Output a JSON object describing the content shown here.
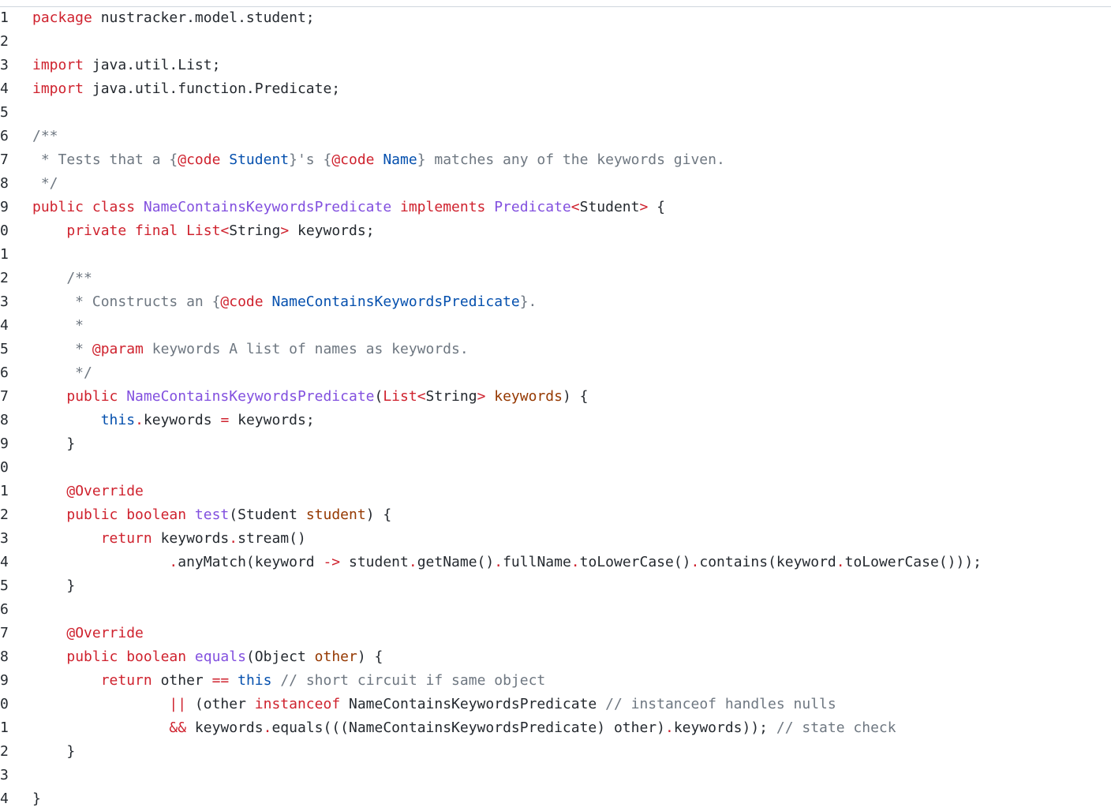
{
  "editor": {
    "line_numbers": [
      "1",
      "2",
      "3",
      "4",
      "5",
      "6",
      "7",
      "8",
      "9",
      "0",
      "1",
      "2",
      "3",
      "4",
      "5",
      "6",
      "7",
      "8",
      "9",
      "0",
      "1",
      "2",
      "3",
      "4",
      "5",
      "6",
      "7",
      "8",
      "9",
      "0",
      "1",
      "2",
      "3",
      "4"
    ],
    "lines": [
      [
        {
          "t": "package",
          "c": "kw"
        },
        {
          "t": " nustracker.model.student;",
          "c": ""
        }
      ],
      [],
      [
        {
          "t": "import",
          "c": "kw"
        },
        {
          "t": " java.util.List;",
          "c": ""
        }
      ],
      [
        {
          "t": "import",
          "c": "kw"
        },
        {
          "t": " java.util.function.Predicate;",
          "c": ""
        }
      ],
      [],
      [
        {
          "t": "/**",
          "c": "cm"
        }
      ],
      [
        {
          "t": " * Tests that a {",
          "c": "cm"
        },
        {
          "t": "@code",
          "c": "kw"
        },
        {
          "t": " Student",
          "c": "cst"
        },
        {
          "t": "}'s {",
          "c": "cm"
        },
        {
          "t": "@code",
          "c": "kw"
        },
        {
          "t": " Name",
          "c": "cst"
        },
        {
          "t": "} matches any of the keywords given.",
          "c": "cm"
        }
      ],
      [
        {
          "t": " */",
          "c": "cm"
        }
      ],
      [
        {
          "t": "public class ",
          "c": "kw"
        },
        {
          "t": "NameContainsKeywordsPredicate",
          "c": "ent"
        },
        {
          "t": " implements ",
          "c": "kw"
        },
        {
          "t": "Predicate",
          "c": "ent"
        },
        {
          "t": "<",
          "c": "op"
        },
        {
          "t": "Student",
          "c": ""
        },
        {
          "t": ">",
          "c": "op"
        },
        {
          "t": " {",
          "c": ""
        }
      ],
      [
        {
          "t": "    ",
          "c": ""
        },
        {
          "t": "private final List",
          "c": "kw"
        },
        {
          "t": "<",
          "c": "op"
        },
        {
          "t": "String",
          "c": ""
        },
        {
          "t": ">",
          "c": "op"
        },
        {
          "t": " keywords;",
          "c": ""
        }
      ],
      [],
      [
        {
          "t": "    /**",
          "c": "cm"
        }
      ],
      [
        {
          "t": "     * Constructs an {",
          "c": "cm"
        },
        {
          "t": "@code",
          "c": "kw"
        },
        {
          "t": " NameContainsKeywordsPredicate",
          "c": "cst"
        },
        {
          "t": "}.",
          "c": "cm"
        }
      ],
      [
        {
          "t": "     *",
          "c": "cm"
        }
      ],
      [
        {
          "t": "     * ",
          "c": "cm"
        },
        {
          "t": "@param",
          "c": "kw"
        },
        {
          "t": " keywords A list of names as keywords.",
          "c": "cm"
        }
      ],
      [
        {
          "t": "     */",
          "c": "cm"
        }
      ],
      [
        {
          "t": "    ",
          "c": ""
        },
        {
          "t": "public ",
          "c": "kw"
        },
        {
          "t": "NameContainsKeywordsPredicate",
          "c": "ent"
        },
        {
          "t": "(",
          "c": ""
        },
        {
          "t": "List",
          "c": "kw"
        },
        {
          "t": "<",
          "c": "op"
        },
        {
          "t": "String",
          "c": ""
        },
        {
          "t": ">",
          "c": "op"
        },
        {
          "t": " keywords",
          "c": "par"
        },
        {
          "t": ") {",
          "c": ""
        }
      ],
      [
        {
          "t": "        ",
          "c": ""
        },
        {
          "t": "this",
          "c": "cst"
        },
        {
          "t": ".",
          "c": "op"
        },
        {
          "t": "keywords ",
          "c": ""
        },
        {
          "t": "=",
          "c": "op"
        },
        {
          "t": " keywords;",
          "c": ""
        }
      ],
      [
        {
          "t": "    }",
          "c": ""
        }
      ],
      [],
      [
        {
          "t": "    ",
          "c": ""
        },
        {
          "t": "@Override",
          "c": "kw"
        }
      ],
      [
        {
          "t": "    ",
          "c": ""
        },
        {
          "t": "public boolean ",
          "c": "kw"
        },
        {
          "t": "test",
          "c": "ent"
        },
        {
          "t": "(Student ",
          "c": ""
        },
        {
          "t": "student",
          "c": "par"
        },
        {
          "t": ") {",
          "c": ""
        }
      ],
      [
        {
          "t": "        ",
          "c": ""
        },
        {
          "t": "return",
          "c": "kw"
        },
        {
          "t": " keywords",
          "c": ""
        },
        {
          "t": ".",
          "c": "op"
        },
        {
          "t": "stream()",
          "c": ""
        }
      ],
      [
        {
          "t": "                ",
          "c": ""
        },
        {
          "t": ".",
          "c": "op"
        },
        {
          "t": "anyMatch(keyword ",
          "c": ""
        },
        {
          "t": "->",
          "c": "op"
        },
        {
          "t": " student",
          "c": ""
        },
        {
          "t": ".",
          "c": "op"
        },
        {
          "t": "getName()",
          "c": ""
        },
        {
          "t": ".",
          "c": "op"
        },
        {
          "t": "fullName",
          "c": ""
        },
        {
          "t": ".",
          "c": "op"
        },
        {
          "t": "toLowerCase()",
          "c": ""
        },
        {
          "t": ".",
          "c": "op"
        },
        {
          "t": "contains(keyword",
          "c": ""
        },
        {
          "t": ".",
          "c": "op"
        },
        {
          "t": "toLowerCase()));",
          "c": ""
        }
      ],
      [
        {
          "t": "    }",
          "c": ""
        }
      ],
      [],
      [
        {
          "t": "    ",
          "c": ""
        },
        {
          "t": "@Override",
          "c": "kw"
        }
      ],
      [
        {
          "t": "    ",
          "c": ""
        },
        {
          "t": "public boolean ",
          "c": "kw"
        },
        {
          "t": "equals",
          "c": "ent"
        },
        {
          "t": "(Object ",
          "c": ""
        },
        {
          "t": "other",
          "c": "par"
        },
        {
          "t": ") {",
          "c": ""
        }
      ],
      [
        {
          "t": "        ",
          "c": ""
        },
        {
          "t": "return",
          "c": "kw"
        },
        {
          "t": " other ",
          "c": ""
        },
        {
          "t": "==",
          "c": "op"
        },
        {
          "t": " ",
          "c": ""
        },
        {
          "t": "this",
          "c": "cst"
        },
        {
          "t": " // short circuit if same object",
          "c": "cm"
        }
      ],
      [
        {
          "t": "                ",
          "c": ""
        },
        {
          "t": "||",
          "c": "op"
        },
        {
          "t": " (other ",
          "c": ""
        },
        {
          "t": "instanceof",
          "c": "kw"
        },
        {
          "t": " NameContainsKeywordsPredicate ",
          "c": ""
        },
        {
          "t": "// instanceof handles nulls",
          "c": "cm"
        }
      ],
      [
        {
          "t": "                ",
          "c": ""
        },
        {
          "t": "&&",
          "c": "op"
        },
        {
          "t": " keywords",
          "c": ""
        },
        {
          "t": ".",
          "c": "op"
        },
        {
          "t": "equals(((NameContainsKeywordsPredicate) other)",
          "c": ""
        },
        {
          "t": ".",
          "c": "op"
        },
        {
          "t": "keywords)); ",
          "c": ""
        },
        {
          "t": "// state check",
          "c": "cm"
        }
      ],
      [
        {
          "t": "    }",
          "c": ""
        }
      ],
      [],
      [
        {
          "t": "}",
          "c": ""
        }
      ]
    ]
  }
}
